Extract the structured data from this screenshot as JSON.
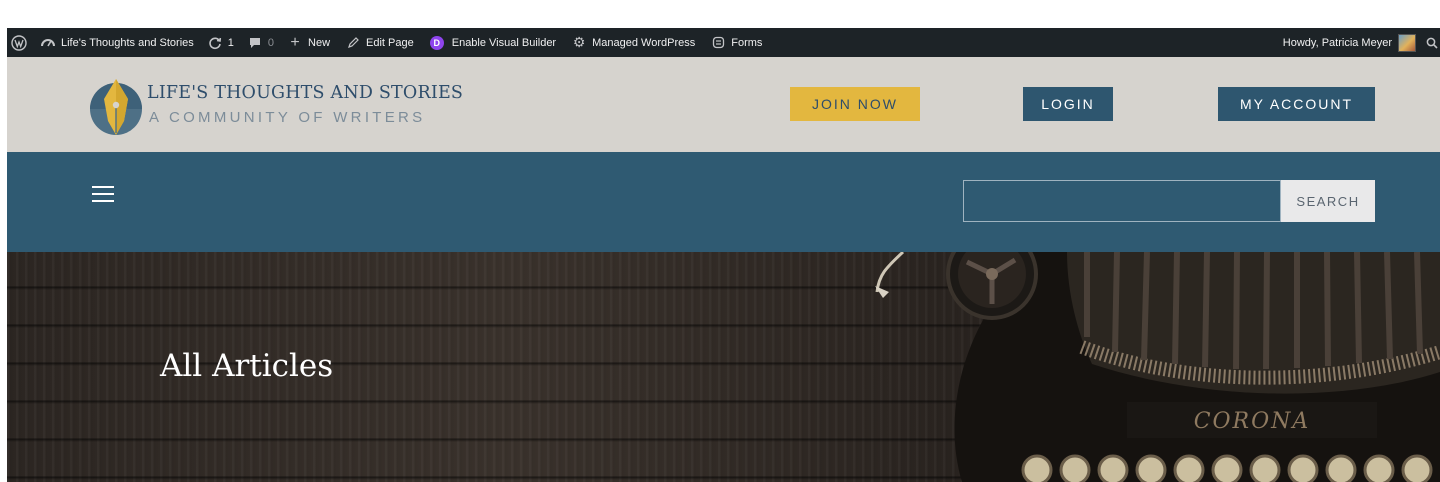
{
  "admin_bar": {
    "site_name": "Life's Thoughts and Stories",
    "updates_count": "1",
    "comments_count": "0",
    "new_label": "New",
    "edit_page_label": "Edit Page",
    "visual_builder_label": "Enable Visual Builder",
    "visual_builder_badge": "D",
    "managed_wp_label": "Managed WordPress",
    "forms_label": "Forms",
    "greeting": "Howdy, Patricia Meyer"
  },
  "header": {
    "title": "LIFE'S THOUGHTS AND STORIES",
    "subtitle": "A COMMUNITY OF WRITERS",
    "join_label": "JOIN NOW",
    "login_label": "LOGIN",
    "account_label": "MY ACCOUNT"
  },
  "nav": {
    "search_value": "",
    "search_button": "SEARCH"
  },
  "hero": {
    "title": "All Articles",
    "typewriter_brand": "CORONA"
  },
  "colors": {
    "admin_bar_bg": "#1d2327",
    "header_bg": "#d6d3ce",
    "brand_blue": "#2e566f",
    "nav_bg": "#2f5a72",
    "accent_yellow": "#e3b73f",
    "visual_builder_purple": "#8e44ed"
  }
}
